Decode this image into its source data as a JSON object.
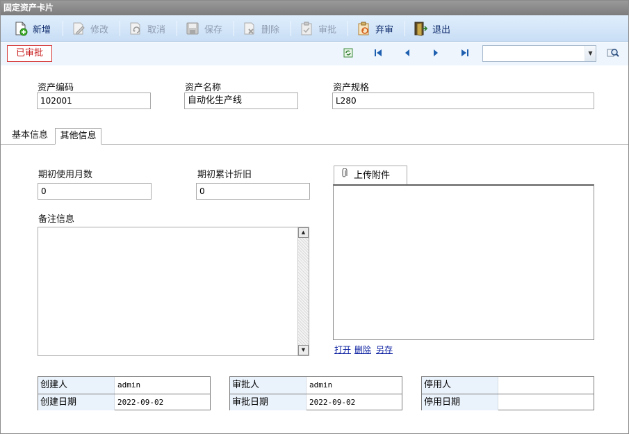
{
  "window": {
    "title": "固定资产卡片"
  },
  "toolbar": {
    "new_label": "新增",
    "edit_label": "修改",
    "cancel_label": "取消",
    "save_label": "保存",
    "delete_label": "删除",
    "approve_label": "审批",
    "unapprove_label": "弃审",
    "exit_label": "退出"
  },
  "status": {
    "badge": "已审批"
  },
  "navigator": {
    "search_value": ""
  },
  "header_fields": {
    "code_label": "资产编码",
    "code_value": "102001",
    "name_label": "资产名称",
    "name_value": "自动化生产线",
    "spec_label": "资产规格",
    "spec_value": "L280"
  },
  "tabs": [
    {
      "label": "基本信息"
    },
    {
      "label": "其他信息"
    }
  ],
  "other_info": {
    "initial_months_label": "期初使用月数",
    "initial_months_value": "0",
    "initial_depr_label": "期初累计折旧",
    "initial_depr_value": "0",
    "remark_label": "备注信息",
    "remark_value": ""
  },
  "attachment": {
    "tab_label": "上传附件",
    "open_link": "打开",
    "delete_link": "删除",
    "saveas_link": "另存"
  },
  "audit": {
    "creator_label": "创建人",
    "creator_value": "admin",
    "created_date_label": "创建日期",
    "created_date_value": "2022-09-02",
    "approver_label": "审批人",
    "approver_value": "admin",
    "approved_date_label": "审批日期",
    "approved_date_value": "2022-09-02",
    "disabler_label": "停用人",
    "disabler_value": "",
    "disabled_date_label": "停用日期",
    "disabled_date_value": ""
  },
  "colors": {
    "toolbar_bg": "#c9def5",
    "status_red": "#c81e1e",
    "link_blue": "#0a1fa0"
  }
}
